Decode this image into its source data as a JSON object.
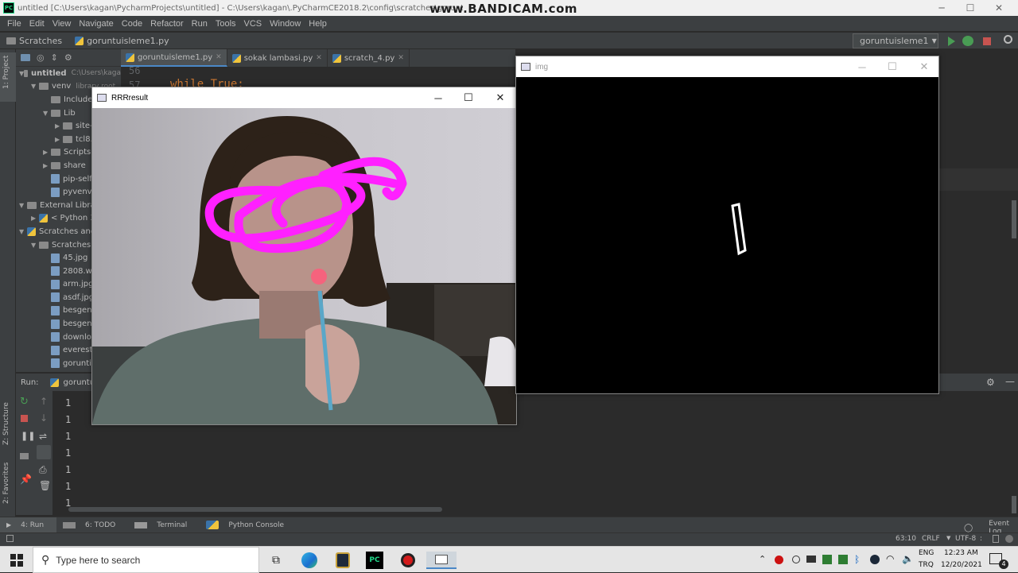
{
  "window": {
    "title": "untitled [C:\\Users\\kagan\\PycharmProjects\\untitled] - C:\\Users\\kagan\\.PyCharmCE2018.2\\config\\scratches\\goruntuisleme1.py",
    "watermark": "www.BANDICAM.com",
    "controls": {
      "minimize": "─",
      "maximize": "☐",
      "close": "✕"
    }
  },
  "menu": [
    "File",
    "Edit",
    "View",
    "Navigate",
    "Code",
    "Refactor",
    "Run",
    "Tools",
    "VCS",
    "Window",
    "Help"
  ],
  "navbar": {
    "crumb1": "Scratches",
    "crumb2": "goruntuisleme1.py",
    "run_config": "goruntuisleme1"
  },
  "left_stripe": {
    "project": "1: Project",
    "structure": "Z: Structure",
    "favorites": "2: Favorites"
  },
  "project_tree": [
    {
      "label": "untitled",
      "extra": "C:\\Users\\kaga",
      "indent": 0,
      "arrow": "▼",
      "icon": "folder"
    },
    {
      "label": "venv",
      "extra": "library root",
      "indent": 1,
      "arrow": "▼",
      "icon": "folder"
    },
    {
      "label": "Include",
      "extra": "",
      "indent": 2,
      "arrow": "",
      "icon": "folder"
    },
    {
      "label": "Lib",
      "extra": "",
      "indent": 2,
      "arrow": "▼",
      "icon": "folder"
    },
    {
      "label": "site-",
      "extra": "",
      "indent": 3,
      "arrow": "▶",
      "icon": "folder"
    },
    {
      "label": "tcl8.",
      "extra": "",
      "indent": 3,
      "arrow": "▶",
      "icon": "folder"
    },
    {
      "label": "Scripts",
      "extra": "",
      "indent": 2,
      "arrow": "▶",
      "icon": "folder"
    },
    {
      "label": "share",
      "extra": "",
      "indent": 2,
      "arrow": "▶",
      "icon": "folder"
    },
    {
      "label": "pip-selfc",
      "extra": "",
      "indent": 2,
      "arrow": "",
      "icon": "file"
    },
    {
      "label": "pyvenv.c",
      "extra": "",
      "indent": 2,
      "arrow": "",
      "icon": "file"
    },
    {
      "label": "External Librar",
      "extra": "",
      "indent": 0,
      "arrow": "▼",
      "icon": "lib"
    },
    {
      "label": "< Python 3.",
      "extra": "",
      "indent": 1,
      "arrow": "▶",
      "icon": "py"
    },
    {
      "label": "Scratches and",
      "extra": "",
      "indent": 0,
      "arrow": "▼",
      "icon": "scratch"
    },
    {
      "label": "Scratches",
      "extra": "",
      "indent": 1,
      "arrow": "▼",
      "icon": "folder"
    },
    {
      "label": "45.jpg",
      "extra": "",
      "indent": 2,
      "arrow": "",
      "icon": "file"
    },
    {
      "label": "2808.we",
      "extra": "",
      "indent": 2,
      "arrow": "",
      "icon": "file"
    },
    {
      "label": "arm.jpg",
      "extra": "",
      "indent": 2,
      "arrow": "",
      "icon": "file"
    },
    {
      "label": "asdf.jpg",
      "extra": "",
      "indent": 2,
      "arrow": "",
      "icon": "file"
    },
    {
      "label": "besgen",
      "extra": "",
      "indent": 2,
      "arrow": "",
      "icon": "file"
    },
    {
      "label": "besgen",
      "extra": "",
      "indent": 2,
      "arrow": "",
      "icon": "file"
    },
    {
      "label": "downlo",
      "extra": "",
      "indent": 2,
      "arrow": "",
      "icon": "file"
    },
    {
      "label": "everest.",
      "extra": "",
      "indent": 2,
      "arrow": "",
      "icon": "file"
    },
    {
      "label": "gorunti",
      "extra": "",
      "indent": 2,
      "arrow": "",
      "icon": "file"
    }
  ],
  "editor": {
    "tabs": [
      {
        "label": "goruntuisleme1.py",
        "active": true
      },
      {
        "label": "sokak lambasi.py",
        "active": false
      },
      {
        "label": "scratch_4.py",
        "active": false
      }
    ],
    "line_numbers": [
      "56",
      "57"
    ],
    "code_line": "while True:"
  },
  "run_panel": {
    "label": "Run:",
    "config": "goruntuisleme1",
    "output": [
      "1",
      "1",
      "1",
      "1",
      "1",
      "1",
      "1"
    ]
  },
  "bottom_tabs": [
    "4: Run",
    "6: TODO",
    "Terminal",
    "Python Console"
  ],
  "event_log": "Event Log",
  "status": {
    "position": "63:10",
    "line_sep": "CRLF",
    "encoding": "UTF-8",
    "separator": ":"
  },
  "window_result": {
    "title": "RRRresult"
  },
  "window_img": {
    "title": "img"
  },
  "taskbar": {
    "search_placeholder": "Type here to search",
    "lang_top": "ENG",
    "lang_bottom": "TRQ",
    "time": "12:23 AM",
    "date": "12/20/2021",
    "notifications": "4",
    "pycharm_badge": "PC"
  },
  "colors": {
    "accent": "#4a88c7",
    "run_green": "#499c54",
    "stop_red": "#c75450",
    "drawing": "#ff20ff"
  }
}
